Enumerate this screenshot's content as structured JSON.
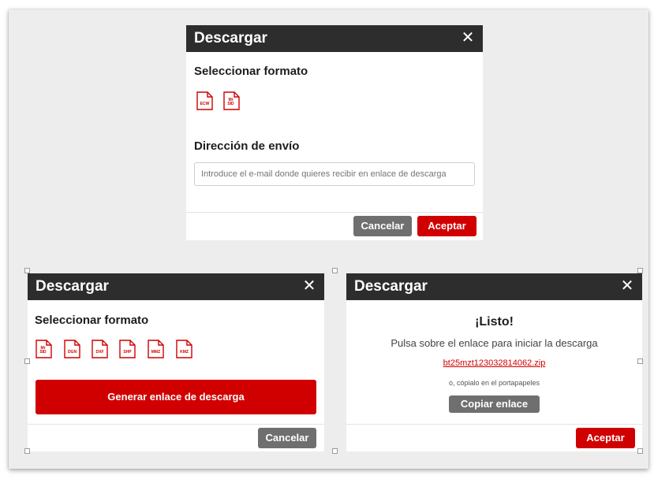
{
  "dialog1": {
    "title": "Descargar",
    "close": "✕",
    "section_format": "Seleccionar formato",
    "formats": [
      "ECW",
      "Mr SID"
    ],
    "section_address": "Dirección de envío",
    "email_placeholder": "Introduce el e-mail donde quieres recibir en enlace de descarga",
    "cancel_label": "Cancelar",
    "accept_label": "Aceptar"
  },
  "dialog2": {
    "title": "Descargar",
    "close": "✕",
    "section_format": "Seleccionar formato",
    "formats": [
      "Mr SID",
      "DGN",
      "DXF",
      "SHP",
      "MMZ",
      "KMZ"
    ],
    "generate_label": "Generar enlace de descarga",
    "cancel_label": "Cancelar"
  },
  "dialog3": {
    "title": "Descargar",
    "close": "✕",
    "ready": "¡Listo!",
    "instruction": "Pulsa sobre el enlace para iniciar la descarga",
    "link": "bt25mzt123032814062.zip",
    "copy_hint": "o, cópialo en el portapapeles",
    "copy_label": "Copiar enlace",
    "accept_label": "Aceptar"
  },
  "colors": {
    "header": "#2d2d2d",
    "accent": "#d10000",
    "secondary_button": "#6f6f6f",
    "background": "#ededed"
  }
}
